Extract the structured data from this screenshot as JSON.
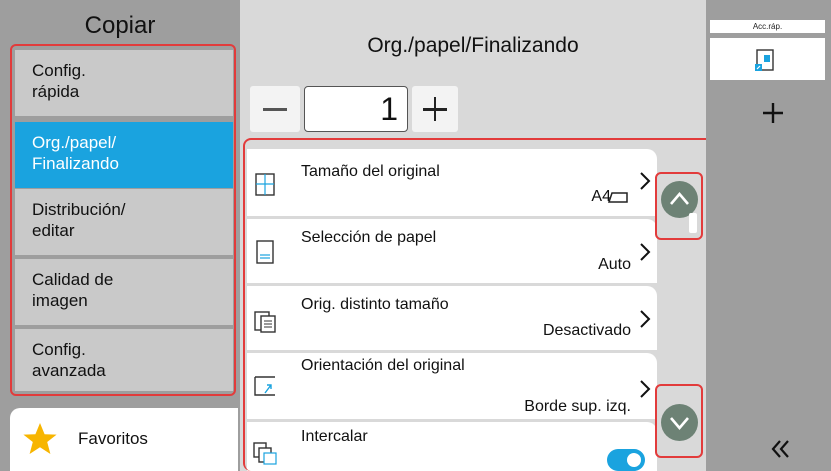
{
  "left_panel": {
    "title": "Copiar",
    "tabs": [
      {
        "line1": "Config.",
        "line2": "rápida"
      },
      {
        "line1": "Org./papel/",
        "line2": "Finalizando"
      },
      {
        "line1": "Distribución/",
        "line2": "editar"
      },
      {
        "line1": "Calidad de",
        "line2": "imagen"
      },
      {
        "line1": "Config.",
        "line2": "avanzada"
      }
    ],
    "favorites_label": "Favoritos"
  },
  "main": {
    "title": "Org./papel/Finalizando",
    "copies": "1",
    "items": [
      {
        "name": "Tamaño del original",
        "value": "A4",
        "icon": "original-size-icon"
      },
      {
        "name": "Selección de papel",
        "value": "Auto",
        "icon": "paper-selection-icon"
      },
      {
        "name": "Orig. distinto tamaño",
        "value": "Desactivado",
        "icon": "mixed-size-icon"
      },
      {
        "name": "Orientación del original",
        "value": "Borde sup. izq.",
        "icon": "orientation-icon"
      },
      {
        "name": "Intercalar",
        "value": "",
        "icon": "collate-icon"
      }
    ],
    "collate_toggle_on": true
  },
  "right_panel": {
    "quick_label": "Acc.ráp."
  },
  "colors": {
    "accent": "#1aa3df",
    "highlight_outline": "#e23b3b",
    "panel_gray": "#9e9e9e",
    "scroll_button": "#6d8275"
  }
}
